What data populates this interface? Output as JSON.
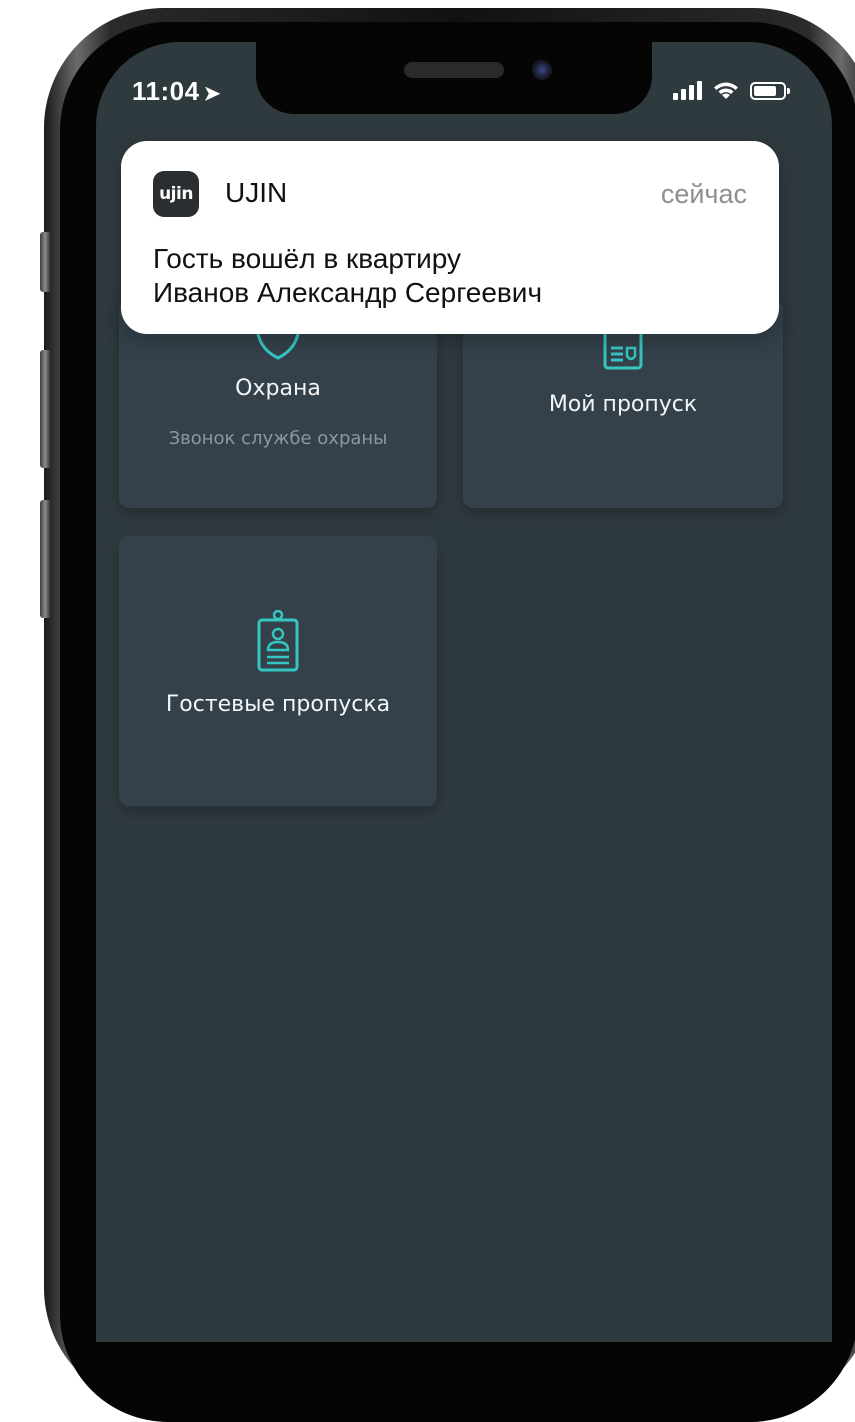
{
  "status_bar": {
    "time": "11:04",
    "location_icon": "location-arrow-icon",
    "signal_icon": "cellular-signal-icon",
    "wifi_icon": "wifi-icon",
    "battery_icon": "battery-icon"
  },
  "notification": {
    "app_icon_text": "ujin",
    "app_name": "UJIN",
    "time": "сейчас",
    "line1": "Гость вошёл в квартиру",
    "line2": "Иванов Александр Сергеевич"
  },
  "tiles": {
    "security": {
      "title": "Охрана",
      "subtitle": "Звонок службе охраны",
      "icon": "shield-icon"
    },
    "my_pass": {
      "title": "Мой пропуск",
      "icon": "pass-card-icon"
    },
    "guest_passes": {
      "title": "Гостевые пропуска",
      "icon": "badge-icon"
    }
  },
  "colors": {
    "screen_bg": "#2f3a3f",
    "tile_bg": "#34414a",
    "accent": "#35c6c2"
  }
}
